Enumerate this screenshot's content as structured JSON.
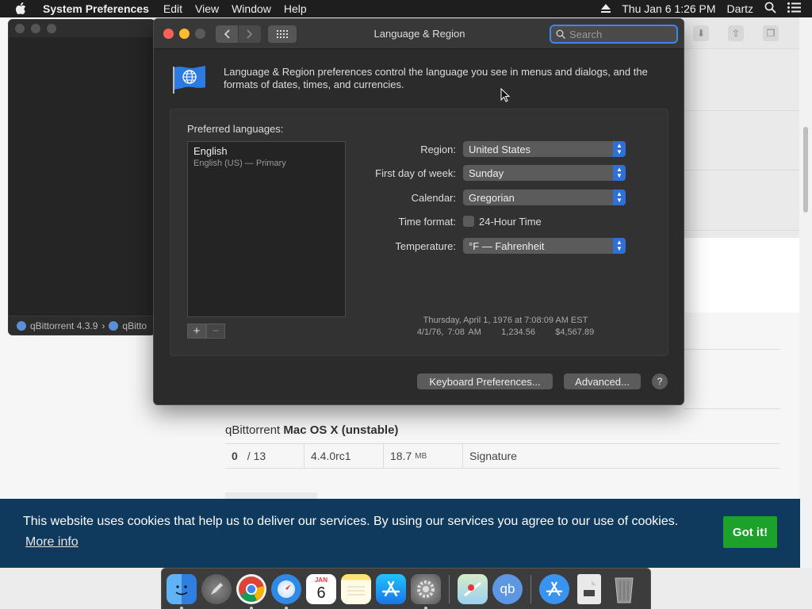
{
  "menubar": {
    "app_name": "System Preferences",
    "menus": [
      "Edit",
      "View",
      "Window",
      "Help"
    ],
    "clock": "Thu Jan 6  1:26 PM",
    "user": "Dartz"
  },
  "qbittorrent_window": {
    "status_items": [
      "qBittorrent 4.3.9",
      "qBitto"
    ]
  },
  "webpage": {
    "section_prefix": "qBittorrent",
    "section_title": "Mac OS X (unstable)",
    "row": {
      "downloads_bold": "0",
      "downloads_rest": "/ 13",
      "version": "4.4.0rc1",
      "size_value": "18.7",
      "size_unit": "MB",
      "signature": "Signature"
    }
  },
  "cookie_banner": {
    "message": "This website uses cookies that help us to deliver our services. By using our services you agree to our use of cookies.",
    "more_info": "More info",
    "accept": "Got it!"
  },
  "prefs_window": {
    "title": "Language & Region",
    "search_placeholder": "Search",
    "description": "Language & Region preferences control the language you see in menus and dialogs, and the formats of dates, times, and currencies.",
    "preferred_languages_label": "Preferred languages:",
    "languages": [
      {
        "name": "English",
        "detail": "English (US) — Primary"
      }
    ],
    "add": "+",
    "remove": "−",
    "fields": {
      "region": {
        "label": "Region:",
        "value": "United States"
      },
      "first_day": {
        "label": "First day of week:",
        "value": "Sunday"
      },
      "calendar": {
        "label": "Calendar:",
        "value": "Gregorian"
      },
      "time_format": {
        "label": "Time format:",
        "checkbox": "24-Hour Time",
        "checked": false
      },
      "temperature": {
        "label": "Temperature:",
        "value": "°F — Fahrenheit"
      }
    },
    "sample_date": "Thursday, April 1, 1976 at 7:08:09 AM EST",
    "sample_numbers": "4/1/76, 7:08 AM     1,234.56     $4,567.89",
    "keyboard_button": "Keyboard Preferences...",
    "advanced_button": "Advanced...",
    "help": "?"
  },
  "dock": {
    "calendar_month": "JAN",
    "calendar_day": "6",
    "qb_label": "qb"
  }
}
